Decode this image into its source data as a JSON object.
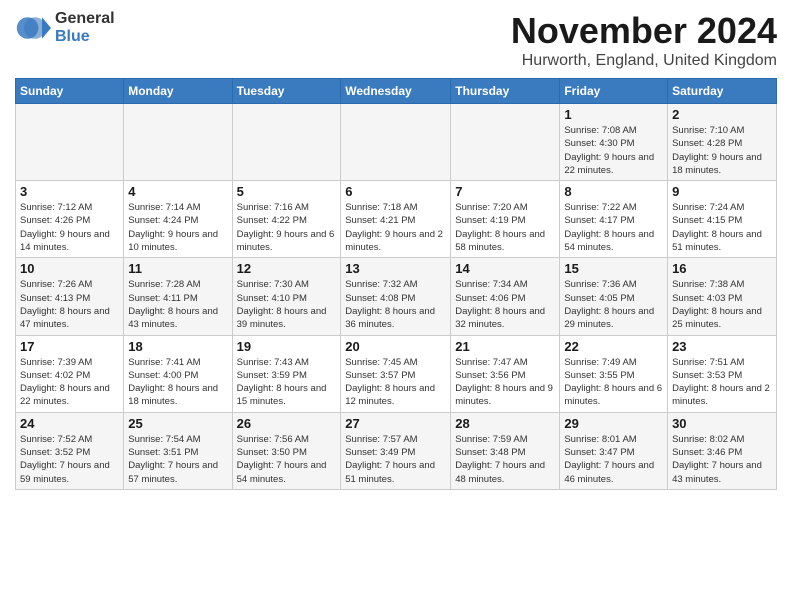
{
  "header": {
    "logo": {
      "general": "General",
      "blue": "Blue"
    },
    "title": "November 2024",
    "location": "Hurworth, England, United Kingdom"
  },
  "calendar": {
    "days_of_week": [
      "Sunday",
      "Monday",
      "Tuesday",
      "Wednesday",
      "Thursday",
      "Friday",
      "Saturday"
    ],
    "weeks": [
      {
        "cells": [
          {
            "day": "",
            "info": ""
          },
          {
            "day": "",
            "info": ""
          },
          {
            "day": "",
            "info": ""
          },
          {
            "day": "",
            "info": ""
          },
          {
            "day": "",
            "info": ""
          },
          {
            "day": "1",
            "info": "Sunrise: 7:08 AM\nSunset: 4:30 PM\nDaylight: 9 hours and 22 minutes."
          },
          {
            "day": "2",
            "info": "Sunrise: 7:10 AM\nSunset: 4:28 PM\nDaylight: 9 hours and 18 minutes."
          }
        ]
      },
      {
        "cells": [
          {
            "day": "3",
            "info": "Sunrise: 7:12 AM\nSunset: 4:26 PM\nDaylight: 9 hours and 14 minutes."
          },
          {
            "day": "4",
            "info": "Sunrise: 7:14 AM\nSunset: 4:24 PM\nDaylight: 9 hours and 10 minutes."
          },
          {
            "day": "5",
            "info": "Sunrise: 7:16 AM\nSunset: 4:22 PM\nDaylight: 9 hours and 6 minutes."
          },
          {
            "day": "6",
            "info": "Sunrise: 7:18 AM\nSunset: 4:21 PM\nDaylight: 9 hours and 2 minutes."
          },
          {
            "day": "7",
            "info": "Sunrise: 7:20 AM\nSunset: 4:19 PM\nDaylight: 8 hours and 58 minutes."
          },
          {
            "day": "8",
            "info": "Sunrise: 7:22 AM\nSunset: 4:17 PM\nDaylight: 8 hours and 54 minutes."
          },
          {
            "day": "9",
            "info": "Sunrise: 7:24 AM\nSunset: 4:15 PM\nDaylight: 8 hours and 51 minutes."
          }
        ]
      },
      {
        "cells": [
          {
            "day": "10",
            "info": "Sunrise: 7:26 AM\nSunset: 4:13 PM\nDaylight: 8 hours and 47 minutes."
          },
          {
            "day": "11",
            "info": "Sunrise: 7:28 AM\nSunset: 4:11 PM\nDaylight: 8 hours and 43 minutes."
          },
          {
            "day": "12",
            "info": "Sunrise: 7:30 AM\nSunset: 4:10 PM\nDaylight: 8 hours and 39 minutes."
          },
          {
            "day": "13",
            "info": "Sunrise: 7:32 AM\nSunset: 4:08 PM\nDaylight: 8 hours and 36 minutes."
          },
          {
            "day": "14",
            "info": "Sunrise: 7:34 AM\nSunset: 4:06 PM\nDaylight: 8 hours and 32 minutes."
          },
          {
            "day": "15",
            "info": "Sunrise: 7:36 AM\nSunset: 4:05 PM\nDaylight: 8 hours and 29 minutes."
          },
          {
            "day": "16",
            "info": "Sunrise: 7:38 AM\nSunset: 4:03 PM\nDaylight: 8 hours and 25 minutes."
          }
        ]
      },
      {
        "cells": [
          {
            "day": "17",
            "info": "Sunrise: 7:39 AM\nSunset: 4:02 PM\nDaylight: 8 hours and 22 minutes."
          },
          {
            "day": "18",
            "info": "Sunrise: 7:41 AM\nSunset: 4:00 PM\nDaylight: 8 hours and 18 minutes."
          },
          {
            "day": "19",
            "info": "Sunrise: 7:43 AM\nSunset: 3:59 PM\nDaylight: 8 hours and 15 minutes."
          },
          {
            "day": "20",
            "info": "Sunrise: 7:45 AM\nSunset: 3:57 PM\nDaylight: 8 hours and 12 minutes."
          },
          {
            "day": "21",
            "info": "Sunrise: 7:47 AM\nSunset: 3:56 PM\nDaylight: 8 hours and 9 minutes."
          },
          {
            "day": "22",
            "info": "Sunrise: 7:49 AM\nSunset: 3:55 PM\nDaylight: 8 hours and 6 minutes."
          },
          {
            "day": "23",
            "info": "Sunrise: 7:51 AM\nSunset: 3:53 PM\nDaylight: 8 hours and 2 minutes."
          }
        ]
      },
      {
        "cells": [
          {
            "day": "24",
            "info": "Sunrise: 7:52 AM\nSunset: 3:52 PM\nDaylight: 7 hours and 59 minutes."
          },
          {
            "day": "25",
            "info": "Sunrise: 7:54 AM\nSunset: 3:51 PM\nDaylight: 7 hours and 57 minutes."
          },
          {
            "day": "26",
            "info": "Sunrise: 7:56 AM\nSunset: 3:50 PM\nDaylight: 7 hours and 54 minutes."
          },
          {
            "day": "27",
            "info": "Sunrise: 7:57 AM\nSunset: 3:49 PM\nDaylight: 7 hours and 51 minutes."
          },
          {
            "day": "28",
            "info": "Sunrise: 7:59 AM\nSunset: 3:48 PM\nDaylight: 7 hours and 48 minutes."
          },
          {
            "day": "29",
            "info": "Sunrise: 8:01 AM\nSunset: 3:47 PM\nDaylight: 7 hours and 46 minutes."
          },
          {
            "day": "30",
            "info": "Sunrise: 8:02 AM\nSunset: 3:46 PM\nDaylight: 7 hours and 43 minutes."
          }
        ]
      }
    ]
  }
}
